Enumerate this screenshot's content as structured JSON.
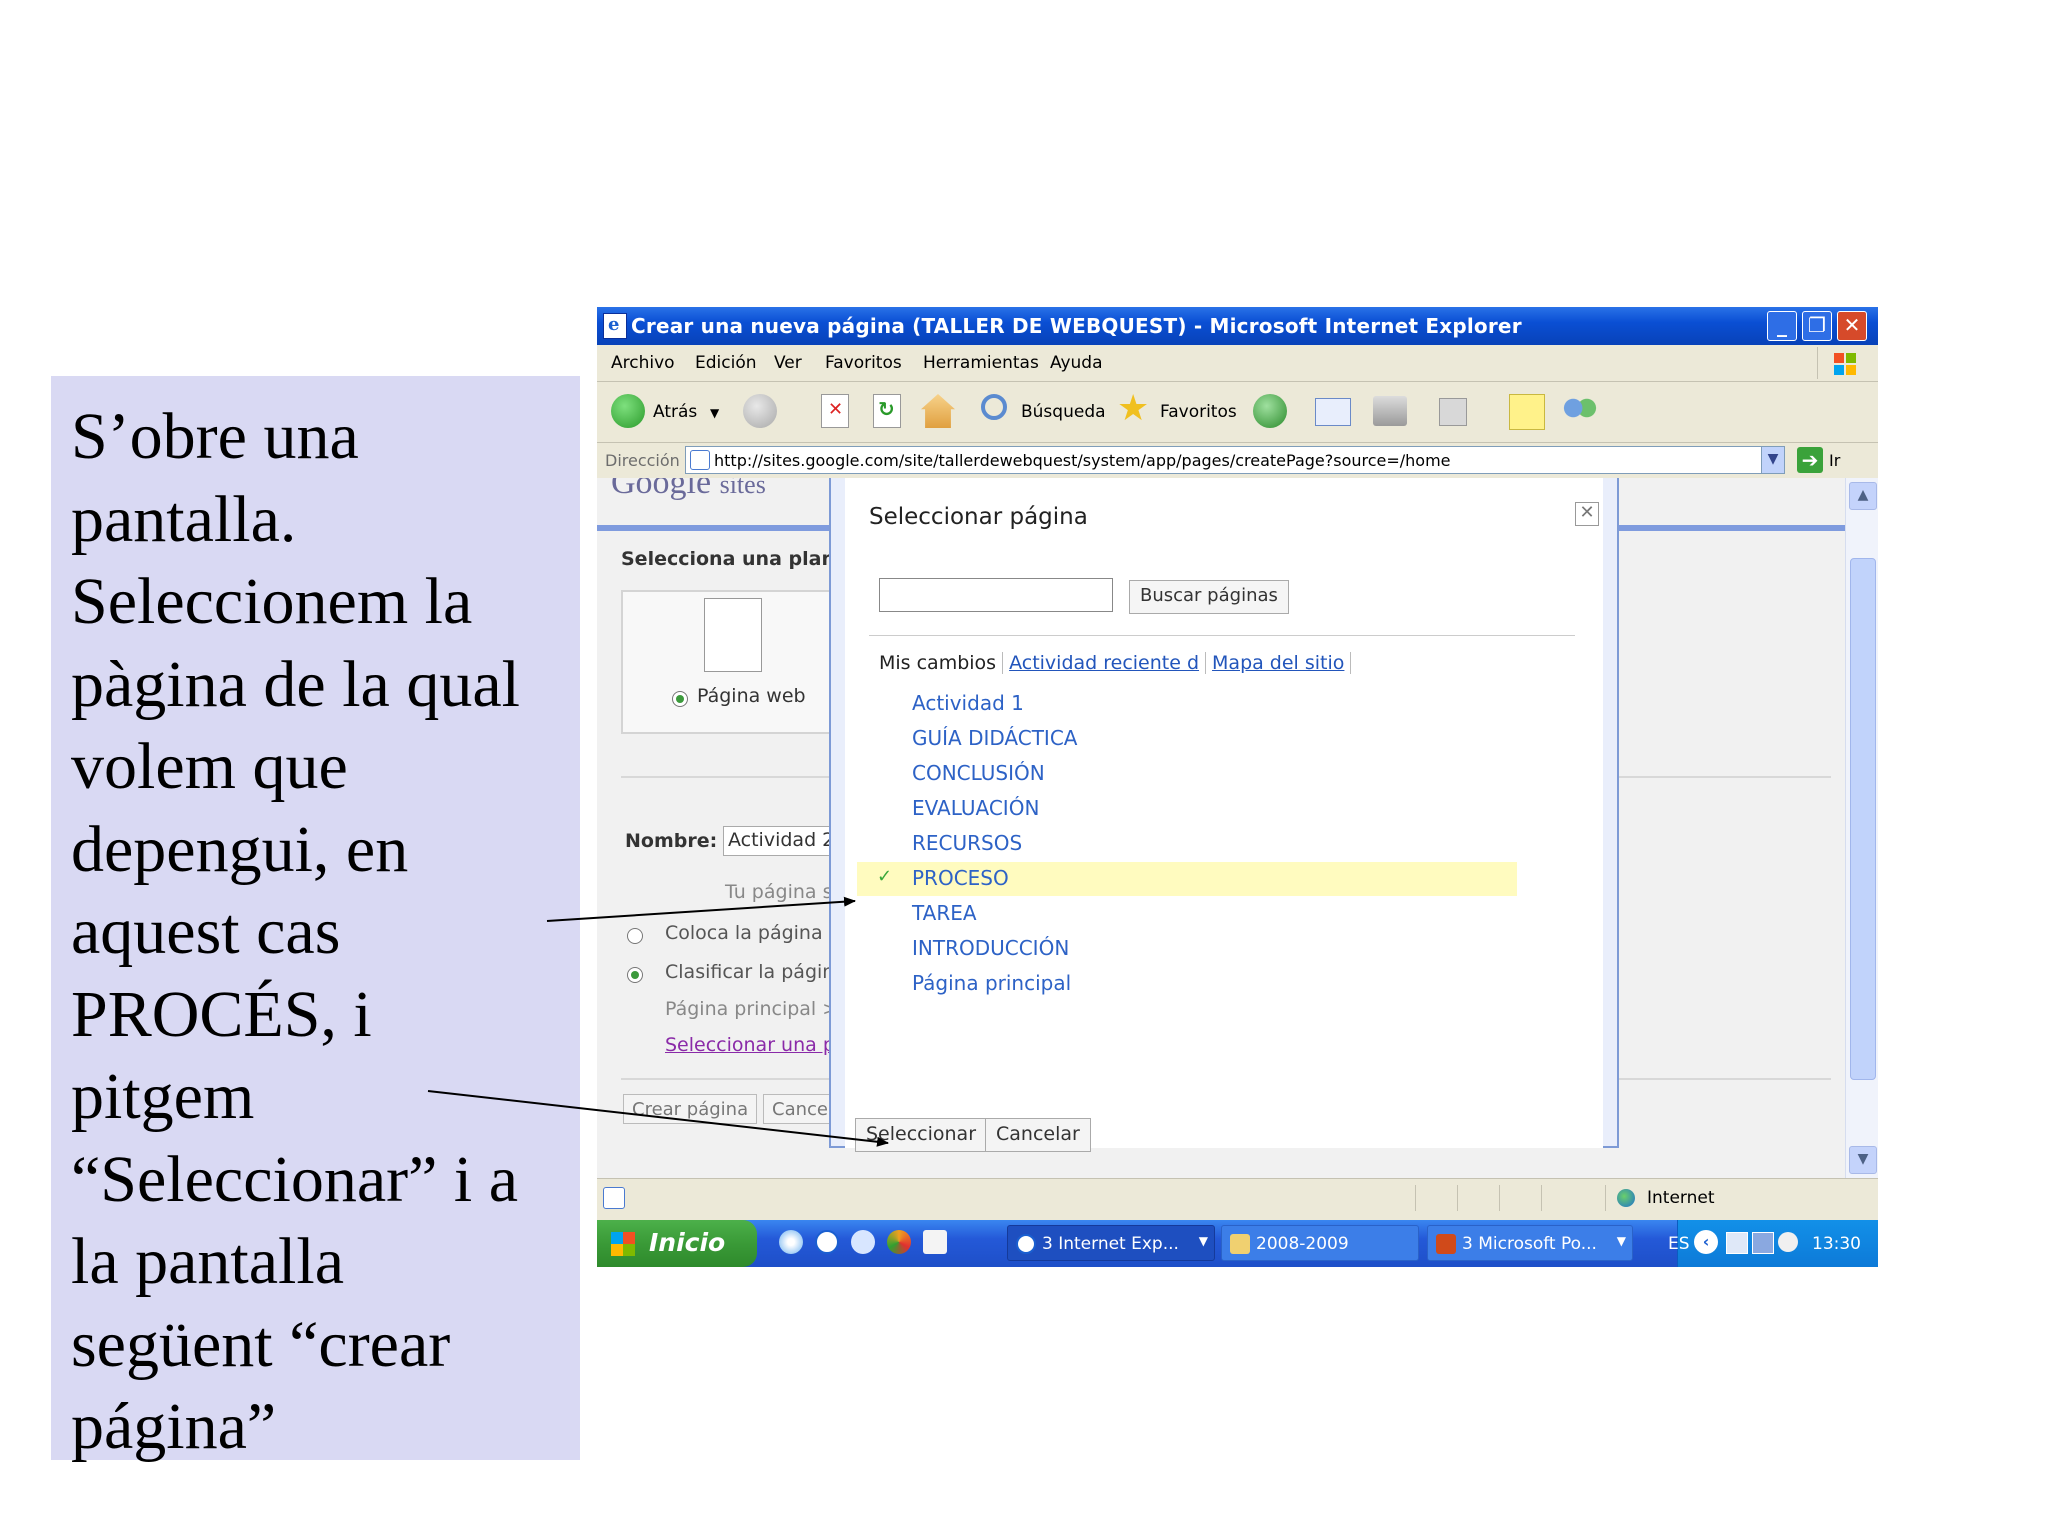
{
  "callout": {
    "lines": [
      "S’obre una",
      "pantalla.",
      "Seleccionem la",
      "pàgina de la qual",
      "volem que",
      "depengui, en",
      "aquest cas",
      "PROCÉS, i",
      "pitgem",
      "“Seleccionar” i a",
      "la pantalla",
      "següent “crear",
      "página”"
    ]
  },
  "window": {
    "title": "Crear una nueva página (TALLER DE WEBQUEST) - Microsoft Internet Explorer",
    "menu": [
      "Archivo",
      "Edición",
      "Ver",
      "Favoritos",
      "Herramientas",
      "Ayuda"
    ],
    "toolbar": {
      "back_label": "Atrás",
      "search_label": "Búsqueda",
      "favorites_label": "Favoritos"
    },
    "address": {
      "label": "Dirección",
      "url": "http://sites.google.com/site/tallerdewebquest/system/app/pages/createPage?source=/home",
      "go_label": "Ir"
    }
  },
  "background_page": {
    "logo": "Google",
    "logo_sites": "sites",
    "select_template": "Selecciona una plan",
    "template_option": "Página web",
    "name_label": "Nombre:",
    "name_value": "Actividad 2",
    "url_hint": "Tu página s",
    "place_top": "Coloca la página",
    "place_under": "Clasificar la págin",
    "parent_path": "Página principal >",
    "select_other": "Seleccionar una p",
    "create_button": "Crear página",
    "cancel_button": "Cance"
  },
  "dialog": {
    "title": "Seleccionar página",
    "search_placeholder": "",
    "search_button": "Buscar páginas",
    "tabs": [
      "Mis cambios",
      "Actividad reciente d",
      "Mapa del sitio"
    ],
    "pages": [
      {
        "label": "Actividad 1",
        "selected": false
      },
      {
        "label": "GUÍA DIDÁCTICA",
        "selected": false
      },
      {
        "label": "CONCLUSIÓN",
        "selected": false
      },
      {
        "label": "EVALUACIÓN",
        "selected": false
      },
      {
        "label": "RECURSOS",
        "selected": false
      },
      {
        "label": "PROCESO",
        "selected": true
      },
      {
        "label": "TAREA",
        "selected": false
      },
      {
        "label": "INTRODUCCIÓN",
        "selected": false
      },
      {
        "label": "Página principal",
        "selected": false
      }
    ],
    "select_button": "Seleccionar",
    "cancel_button": "Cancelar"
  },
  "statusbar": {
    "zone": "Internet"
  },
  "taskbar": {
    "start": "Inicio",
    "tasks": [
      "3 Internet Exp...",
      "2008-2009",
      "3 Microsoft Po..."
    ],
    "language": "ES",
    "clock": "13:30"
  },
  "colors": {
    "callout_bg": "#d9d9f3",
    "titlebar": "#0a4fd4",
    "link": "#2d62c6",
    "selected_row": "#fffbbf"
  }
}
